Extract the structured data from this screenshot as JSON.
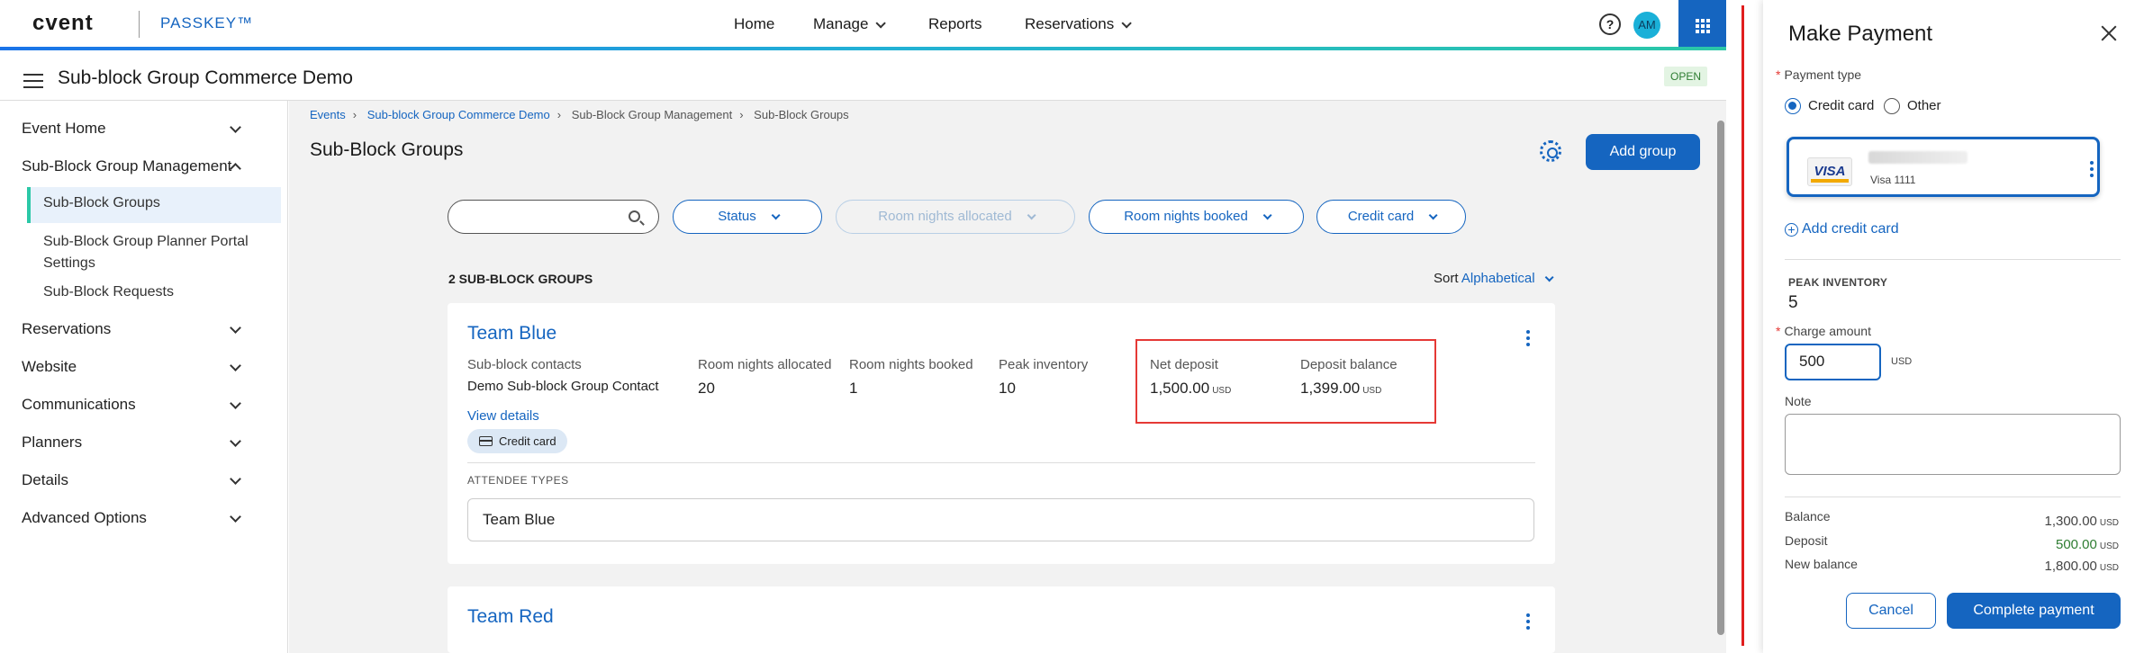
{
  "topnav": {
    "logo": "cvent",
    "product": "PASSKEY™",
    "links": [
      "Home",
      "Manage",
      "Reports",
      "Reservations"
    ],
    "help_glyph": "?",
    "avatar_initials": "AM"
  },
  "subheader": {
    "title": "Sub-block Group Commerce Demo",
    "status_badge": "OPEN"
  },
  "sidebar": {
    "items": [
      {
        "label": "Event Home"
      },
      {
        "label": "Sub-Block Group Management"
      },
      {
        "label": "Sub-Block Groups"
      },
      {
        "label": "Sub-Block Group Planner Portal Settings"
      },
      {
        "label": "Sub-Block Requests"
      },
      {
        "label": "Reservations"
      },
      {
        "label": "Website"
      },
      {
        "label": "Communications"
      },
      {
        "label": "Planners"
      },
      {
        "label": "Details"
      },
      {
        "label": "Advanced Options"
      }
    ]
  },
  "breadcrumb": [
    "Events",
    "Sub-block Group Commerce Demo",
    "Sub-Block Group Management",
    "Sub-Block Groups"
  ],
  "main": {
    "title": "Sub-Block Groups",
    "add_group_label": "Add group",
    "search_placeholder": "",
    "filters": [
      "Status",
      "Room nights allocated",
      "Room nights booked",
      "Credit card"
    ],
    "count_label": "2 SUB-BLOCK GROUPS",
    "sort_label": "Sort",
    "sort_value": "Alphabetical"
  },
  "cards": [
    {
      "name": "Team Blue",
      "contacts_label": "Sub-block contacts",
      "contact_name": "Demo Sub-block Group Contact",
      "view_details": "View details",
      "allocated_label": "Room nights allocated",
      "allocated": "20",
      "booked_label": "Room nights booked",
      "booked": "1",
      "peak_label": "Peak inventory",
      "peak": "10",
      "net_deposit_label": "Net deposit",
      "net_deposit": "1,500.00",
      "deposit_balance_label": "Deposit balance",
      "deposit_balance": "1,399.00",
      "currency": "USD",
      "badge": "Credit card",
      "attendee_types_label": "ATTENDEE TYPES",
      "attendee_type": "Team Blue"
    },
    {
      "name": "Team Red"
    }
  ],
  "panel": {
    "title": "Make Payment",
    "payment_type_label": "Payment type",
    "option_credit": "Credit card",
    "option_other": "Other",
    "card_brand": "VISA",
    "card_number": "Visa 1111",
    "add_card": "Add credit card",
    "add_card_glyph": "+",
    "peak_inventory_label": "PEAK INVENTORY",
    "peak_inventory": "5",
    "charge_label": "Charge amount",
    "charge_value": "500",
    "charge_unit": "USD",
    "note_label": "Note",
    "balance_label": "Balance",
    "balance": "1,300.00",
    "deposit_label": "Deposit",
    "deposit": "500.00",
    "new_balance_label": "New balance",
    "new_balance": "1,800.00",
    "currency": "USD",
    "cancel": "Cancel",
    "complete": "Complete payment",
    "required_mark": "*"
  }
}
